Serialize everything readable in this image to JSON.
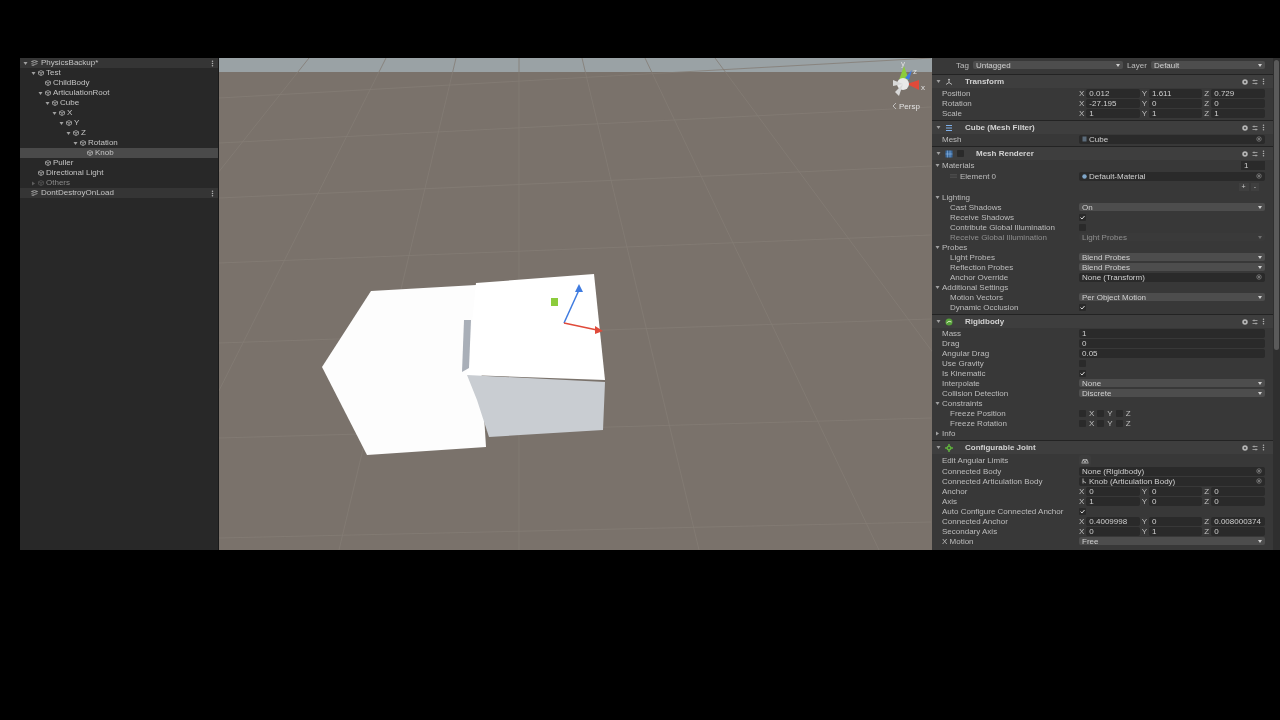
{
  "hierarchy": {
    "scenes": [
      {
        "name": "PhysicsBackup*",
        "expanded": true,
        "items": [
          {
            "name": "Test",
            "expanded": true,
            "selected": false,
            "children": [
              {
                "name": "ChildBody",
                "selected": false
              },
              {
                "name": "ArticulationRoot",
                "expanded": true,
                "selected": false,
                "children": [
                  {
                    "name": "Cube",
                    "expanded": true,
                    "selected": false,
                    "children": [
                      {
                        "name": "X",
                        "expanded": true,
                        "selected": false,
                        "children": [
                          {
                            "name": "Y",
                            "expanded": true,
                            "selected": false,
                            "children": [
                              {
                                "name": "Z",
                                "expanded": true,
                                "selected": false,
                                "children": [
                                  {
                                    "name": "Rotation",
                                    "expanded": true,
                                    "selected": false,
                                    "children": [
                                      {
                                        "name": "Knob",
                                        "selected": true
                                      }
                                    ]
                                  }
                                ]
                              }
                            ]
                          }
                        ]
                      }
                    ]
                  }
                ]
              },
              {
                "name": "Puller",
                "selected": false
              }
            ]
          },
          {
            "name": "Directional Light",
            "selected": false
          },
          {
            "name": "Others",
            "expanded": false,
            "disabled": true,
            "selected": false
          }
        ]
      },
      {
        "name": "DontDestroyOnLoad",
        "expanded": false
      }
    ]
  },
  "scene": {
    "view_label": "Persp",
    "gizmo_axes": [
      "y",
      "z",
      "x"
    ]
  },
  "inspector": {
    "tag_label": "Tag",
    "tag": "Untagged",
    "layer_label": "Layer",
    "layer": "Default",
    "components": [
      {
        "kind": "transform",
        "name": "Transform",
        "expanded": true,
        "rows": [
          {
            "kind": "vector",
            "label": "Position",
            "values": [
              {
                "axis": "X",
                "value": "0.012"
              },
              {
                "axis": "Y",
                "value": "1.611"
              },
              {
                "axis": "Z",
                "value": "0.729"
              }
            ]
          },
          {
            "kind": "vector",
            "label": "Rotation",
            "values": [
              {
                "axis": "X",
                "value": "-27.195"
              },
              {
                "axis": "Y",
                "value": "0"
              },
              {
                "axis": "Z",
                "value": "0"
              }
            ]
          },
          {
            "kind": "vector",
            "label": "Scale",
            "values": [
              {
                "axis": "X",
                "value": "1"
              },
              {
                "axis": "Y",
                "value": "1"
              },
              {
                "axis": "Z",
                "value": "1"
              }
            ]
          }
        ]
      },
      {
        "kind": "mesh_filter",
        "name": "Cube (Mesh Filter)",
        "expanded": true,
        "rows": [
          {
            "kind": "mesh",
            "label": "Mesh",
            "value": "Cube"
          }
        ]
      },
      {
        "kind": "mesh_renderer",
        "name": "Mesh Renderer",
        "expanded": true,
        "enabled": false,
        "rows": [
          {
            "kind": "foldout",
            "label": "Materials",
            "expanded": true,
            "size": "1",
            "rows": [
              {
                "kind": "element",
                "label": "Element 0",
                "value": "Default-Material"
              },
              {
                "kind": "list_buttons",
                "buttons": [
                  "+",
                  "-"
                ]
              }
            ]
          },
          {
            "kind": "foldout",
            "label": "Lighting",
            "expanded": true,
            "rows": [
              {
                "kind": "dropdown",
                "label": "Cast Shadows",
                "value": "On",
                "disabled": false
              },
              {
                "kind": "checkbox",
                "label": "Receive Shadows",
                "checked": true
              },
              {
                "kind": "checkbox",
                "label": "Contribute Global Illumination",
                "checked": false
              },
              {
                "kind": "dropdown",
                "label": "Receive Global Illumination",
                "value": "Light Probes",
                "disabled": true
              }
            ]
          },
          {
            "kind": "foldout",
            "label": "Probes",
            "expanded": true,
            "rows": [
              {
                "kind": "dropdown",
                "label": "Light Probes",
                "value": "Blend Probes",
                "disabled": false
              },
              {
                "kind": "dropdown",
                "label": "Reflection Probes",
                "value": "Blend Probes",
                "disabled": false
              },
              {
                "kind": "object",
                "label": "Anchor Override",
                "value": "None (Transform)"
              }
            ]
          },
          {
            "kind": "foldout",
            "label": "Additional Settings",
            "expanded": true,
            "rows": [
              {
                "kind": "dropdown",
                "label": "Motion Vectors",
                "value": "Per Object Motion",
                "disabled": false
              },
              {
                "kind": "checkbox",
                "label": "Dynamic Occlusion",
                "checked": true
              }
            ]
          }
        ]
      },
      {
        "kind": "rigidbody",
        "name": "Rigidbody",
        "expanded": true,
        "rows": [
          {
            "kind": "field",
            "label": "Mass",
            "value": "1"
          },
          {
            "kind": "field",
            "label": "Drag",
            "value": "0"
          },
          {
            "kind": "field",
            "label": "Angular Drag",
            "value": "0.05"
          },
          {
            "kind": "checkbox",
            "label": "Use Gravity",
            "checked": false
          },
          {
            "kind": "checkbox",
            "label": "Is Kinematic",
            "checked": true
          },
          {
            "kind": "dropdown",
            "label": "Interpolate",
            "value": "None",
            "disabled": false
          },
          {
            "kind": "dropdown",
            "label": "Collision Detection",
            "value": "Discrete",
            "disabled": false
          },
          {
            "kind": "foldout",
            "label": "Constraints",
            "expanded": true,
            "rows": [
              {
                "kind": "axes",
                "label": "Freeze Position",
                "axes": [
                  {
                    "axis": "X",
                    "checked": false
                  },
                  {
                    "axis": "Y",
                    "checked": false
                  },
                  {
                    "axis": "Z",
                    "checked": false
                  }
                ]
              },
              {
                "kind": "axes",
                "label": "Freeze Rotation",
                "axes": [
                  {
                    "axis": "X",
                    "checked": false
                  },
                  {
                    "axis": "Y",
                    "checked": false
                  },
                  {
                    "axis": "Z",
                    "checked": false
                  }
                ]
              }
            ]
          },
          {
            "kind": "foldout",
            "label": "Info",
            "expanded": false,
            "rows": []
          }
        ]
      },
      {
        "kind": "joint",
        "name": "Configurable Joint",
        "expanded": true,
        "rows": [
          {
            "kind": "icon_button",
            "label": "Edit Angular Limits"
          },
          {
            "kind": "object",
            "label": "Connected Body",
            "value": "None (Rigidbody)"
          },
          {
            "kind": "body",
            "label": "Connected Articulation Body",
            "value": "Knob (Articulation Body)"
          },
          {
            "kind": "vector",
            "label": "Anchor",
            "values": [
              {
                "axis": "X",
                "value": "0"
              },
              {
                "axis": "Y",
                "value": "0"
              },
              {
                "axis": "Z",
                "value": "0"
              }
            ]
          },
          {
            "kind": "vector",
            "label": "Axis",
            "values": [
              {
                "axis": "X",
                "value": "1"
              },
              {
                "axis": "Y",
                "value": "0"
              },
              {
                "axis": "Z",
                "value": "0"
              }
            ]
          },
          {
            "kind": "checkbox",
            "label": "Auto Configure Connected Anchor",
            "checked": true
          },
          {
            "kind": "vector",
            "label": "Connected Anchor",
            "values": [
              {
                "axis": "X",
                "value": "0.4009998"
              },
              {
                "axis": "Y",
                "value": "0"
              },
              {
                "axis": "Z",
                "value": "0.008000374"
              }
            ]
          },
          {
            "kind": "vector",
            "label": "Secondary Axis",
            "values": [
              {
                "axis": "X",
                "value": "0"
              },
              {
                "axis": "Y",
                "value": "1"
              },
              {
                "axis": "Z",
                "value": "0"
              }
            ]
          },
          {
            "kind": "dropdown",
            "label": "X Motion",
            "value": "Free",
            "disabled": false
          }
        ]
      }
    ]
  }
}
